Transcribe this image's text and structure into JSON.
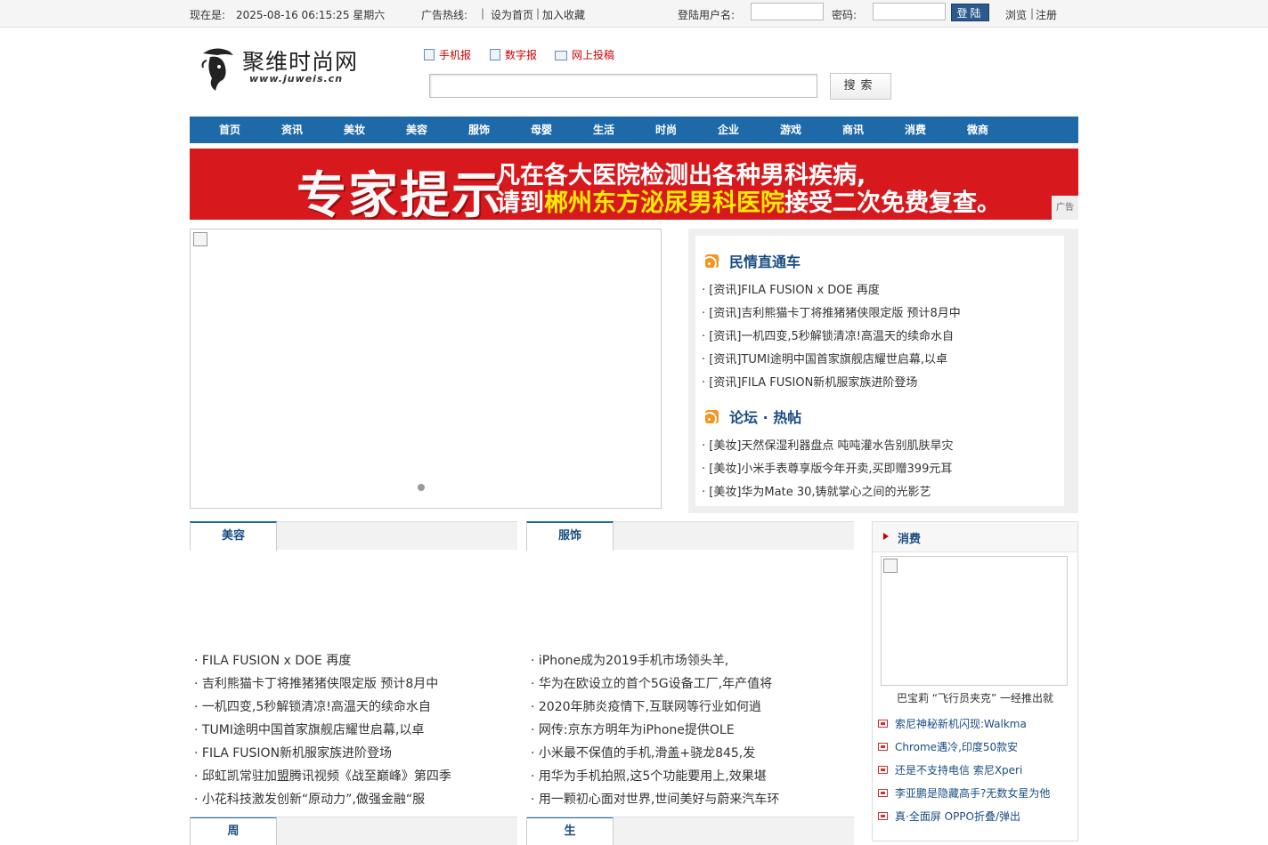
{
  "topbar": {
    "now_label": "现在是:",
    "datetime": "2025-08-16 06:15:25 星期六",
    "ad_hotline": "广告热线:",
    "set_home": "设为首页",
    "sep1": "|",
    "add_fav": "加入收藏",
    "username_label": "登陆用户名:",
    "password_label": "密码:",
    "login_button": "登陆",
    "browse": "浏览",
    "sep2": "|",
    "register": "注册"
  },
  "header": {
    "logo_text": "聚维时尚网",
    "logo_url": "www.juweis.cn",
    "links": [
      "手机报",
      "数字报",
      "网上投稿"
    ],
    "search_button": "搜索"
  },
  "nav": [
    "首页",
    "资讯",
    "美妆",
    "美容",
    "服饰",
    "母婴",
    "生活",
    "时尚",
    "企业",
    "游戏",
    "商讯",
    "消费",
    "微商"
  ],
  "ad": {
    "big": "专家提示",
    "line1": "凡在各大医院检测出各种男科疾病,",
    "line2_pre": "请到",
    "line2_hl": "郴州东方泌尿男科医院",
    "line2_post": "接受二次免费复查。",
    "tag": "广告"
  },
  "hotbox": {
    "section1_title": "民情直通车",
    "section1_items": [
      "· [资讯]FILA FUSION x DOE 再度",
      "· [资讯]吉利熊猫卡丁将推猪猪侠限定版 预计8月中",
      "· [资讯]一机四变,5秒解锁清凉!高温天的续命水自",
      "· [资讯]TUMI途明中国首家旗舰店耀世启幕,以卓",
      "· [资讯]FILA FUSION新机服家族进阶登场"
    ],
    "section2_title": "论坛 · 热帖",
    "section2_items": [
      "· [美妆]天然保湿利器盘点 吨吨灌水告别肌肤旱灾",
      "· [美妆]小米手表尊享版今年开卖,买即赠399元耳",
      "· [美妆]华为Mate 30,铸就掌心之间的光影艺"
    ]
  },
  "beauty": {
    "tab": "美容",
    "items": [
      "· FILA FUSION x DOE 再度",
      "· 吉利熊猫卡丁将推猪猪侠限定版 预计8月中",
      "· 一机四变,5秒解锁清凉!高温天的续命水自",
      "· TUMI途明中国首家旗舰店耀世启幕,以卓",
      "· FILA FUSION新机服家族进阶登场",
      "· 邱虹凯常驻加盟腾讯视频《战至巅峰》第四季",
      "· 小花科技激发创新“原动力”,做强金融“服"
    ],
    "next_tab": "周"
  },
  "apparel": {
    "tab": "服饰",
    "items": [
      "· iPhone成为2019手机市场领头羊,",
      "· 华为在欧设立的首个5G设备工厂,年产值将",
      "· 2020年肺炎疫情下,互联网等行业如何逍",
      "· 网传:京东方明年为iPhone提供OLE",
      "· 小米最不保值的手机,滑盖+骁龙845,发",
      "· 用华为手机拍照,这5个功能要用上,效果堪",
      "· 用一颗初心面对世界,世间美好与蔚来汽车环"
    ],
    "next_tab": "生"
  },
  "consumer": {
    "title": "消费",
    "caption": "巴宝莉 “飞行员夹克” 一经推出就",
    "items": [
      "索尼神秘新机闪现:Walkma",
      "Chrome遇冷,印度50款安",
      "还是不支持电信 索尼Xperi",
      "李亚鹏是隐藏高手?无数女星为他",
      "真·全面屏 OPPO折叠/弹出"
    ]
  }
}
